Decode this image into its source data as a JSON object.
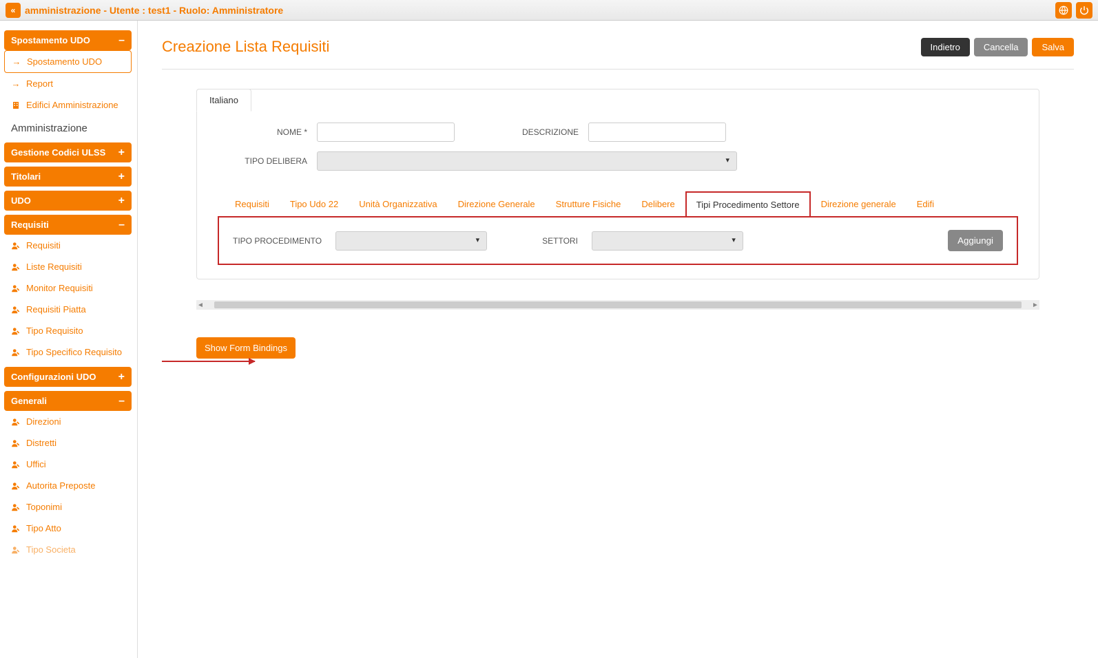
{
  "topbar": {
    "title": "amministrazione - Utente : test1 - Ruolo: Amministratore"
  },
  "sidebar": {
    "section_spostamento": {
      "title": "Spostamento UDO",
      "item": "Spostamento UDO"
    },
    "report": "Report",
    "edifici": "Edifici Amministrazione",
    "amministrazione_label": "Amministrazione",
    "gestione_codici": "Gestione Codici ULSS",
    "titolari": "Titolari",
    "udo": "UDO",
    "requisiti_section": {
      "title": "Requisiti",
      "items": [
        "Requisiti",
        "Liste Requisiti",
        "Monitor Requisiti",
        "Requisiti Piatta",
        "Tipo Requisito",
        "Tipo Specifico Requisito"
      ]
    },
    "config_udo": "Configurazioni UDO",
    "generali_section": {
      "title": "Generali",
      "items": [
        "Direzioni",
        "Distretti",
        "Uffici",
        "Autorita Preposte",
        "Toponimi",
        "Tipo Atto",
        "Tipo Societa"
      ]
    }
  },
  "page": {
    "title": "Creazione Lista Requisiti",
    "buttons": {
      "back": "Indietro",
      "cancel": "Cancella",
      "save": "Salva"
    },
    "lang_tab": "Italiano",
    "form": {
      "nome_label": "NOME *",
      "descrizione_label": "DESCRIZIONE",
      "tipo_delibera_label": "TIPO DELIBERA"
    },
    "tabs": [
      "Requisiti",
      "Tipo Udo 22",
      "Unità Organizzativa",
      "Direzione Generale",
      "Strutture Fisiche",
      "Delibere",
      "Tipi Procedimento Settore",
      "Direzione generale",
      "Edifi"
    ],
    "tab_content": {
      "tipo_procedimento_label": "TIPO PROCEDIMENTO",
      "settori_label": "SETTORI",
      "aggiungi": "Aggiungi"
    },
    "show_bindings": "Show Form Bindings"
  }
}
